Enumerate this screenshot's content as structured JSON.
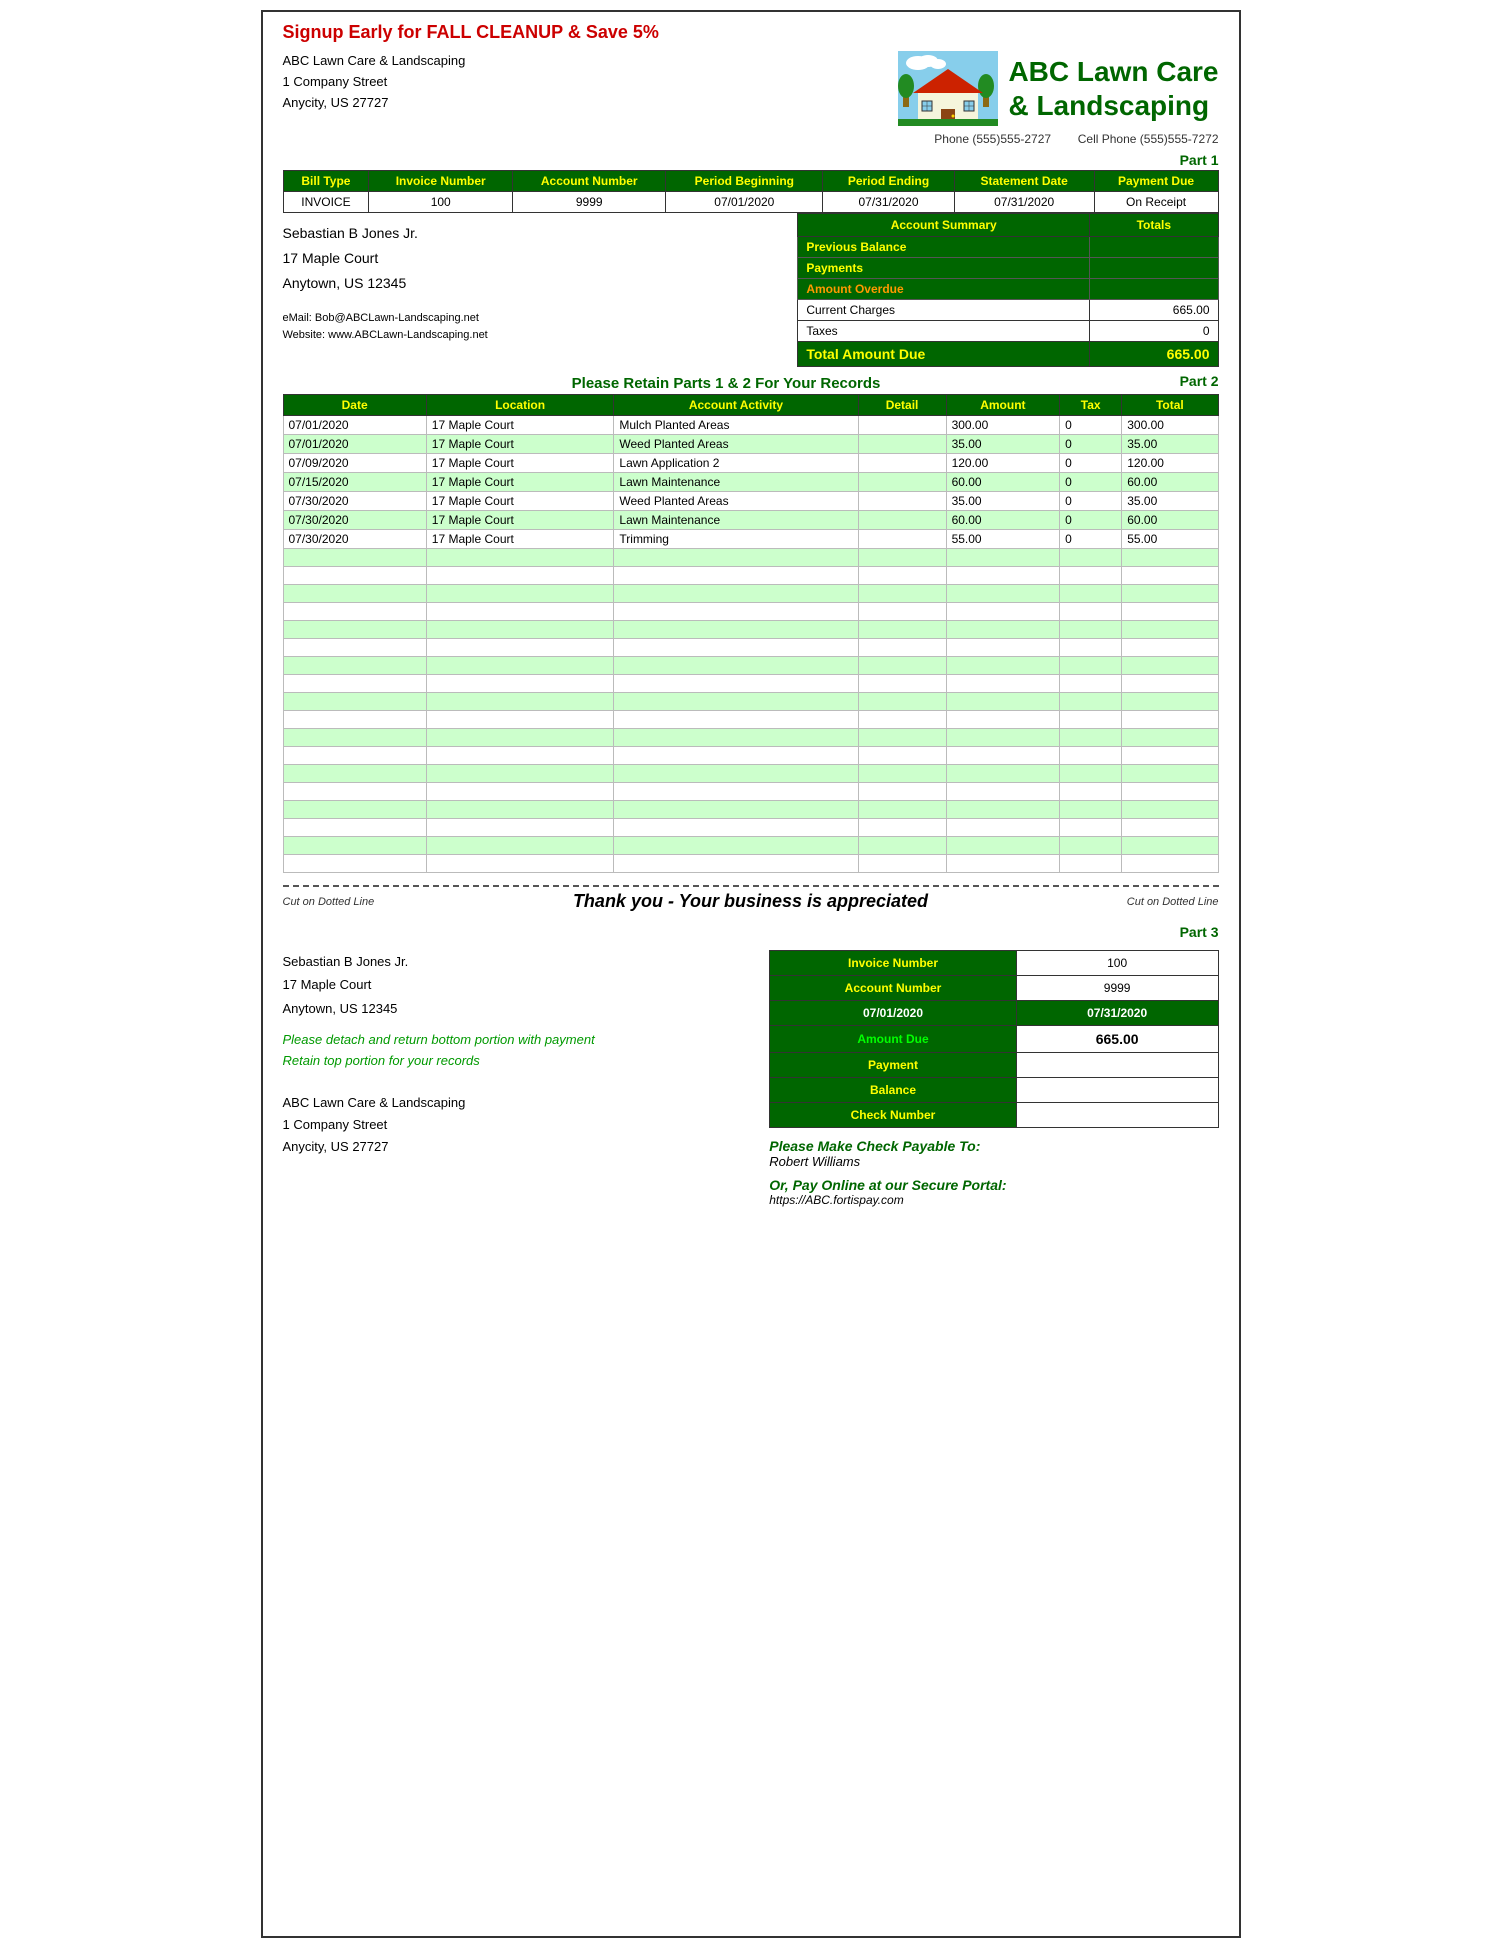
{
  "banner": "Signup Early for FALL CLEANUP & Save 5%",
  "company": {
    "name_line1": "ABC Lawn Care",
    "name_line2": "& Landscaping",
    "address_line1": "ABC Lawn Care & Landscaping",
    "address_line2": "1 Company Street",
    "address_line3": "Anycity, US  27727",
    "phone": "Phone  (555)555-2727",
    "cell": "Cell Phone  (555)555-7272",
    "email": "eMail:  Bob@ABCLawn-Landscaping.net",
    "website": "Website:  www.ABCLawn-Landscaping.net"
  },
  "part1_label": "Part 1",
  "invoice_table": {
    "headers": [
      "Bill Type",
      "Invoice Number",
      "Account Number",
      "Period Beginning",
      "Period Ending",
      "Statement Date",
      "Payment Due"
    ],
    "row": [
      "INVOICE",
      "100",
      "9999",
      "07/01/2020",
      "07/31/2020",
      "07/31/2020",
      "On Receipt"
    ]
  },
  "customer": {
    "name": "Sebastian B Jones Jr.",
    "address1": "17 Maple Court",
    "address2": "Anytown, US  12345"
  },
  "account_summary": {
    "title": "Account Summary",
    "totals_label": "Totals",
    "rows": [
      {
        "label": "Previous Balance",
        "amount": ""
      },
      {
        "label": "Payments",
        "amount": ""
      },
      {
        "label": "Amount Overdue",
        "amount": ""
      },
      {
        "label": "Current Charges",
        "amount": "665.00"
      },
      {
        "label": "Taxes",
        "amount": "0"
      }
    ],
    "total_label": "Total Amount Due",
    "total_amount": "665.00"
  },
  "retain_note": "Please Retain Parts 1 & 2 For Your Records",
  "part2_label": "Part 2",
  "activity_table": {
    "headers": [
      "Date",
      "Location",
      "Account Activity",
      "Detail",
      "Amount",
      "Tax",
      "Total"
    ],
    "rows": [
      {
        "date": "07/01/2020",
        "location": "17 Maple Court",
        "activity": "Mulch Planted Areas",
        "detail": "",
        "amount": "300.00",
        "tax": "0",
        "total": "300.00"
      },
      {
        "date": "07/01/2020",
        "location": "17 Maple Court",
        "activity": "Weed Planted Areas",
        "detail": "",
        "amount": "35.00",
        "tax": "0",
        "total": "35.00"
      },
      {
        "date": "07/09/2020",
        "location": "17 Maple Court",
        "activity": "Lawn Application 2",
        "detail": "",
        "amount": "120.00",
        "tax": "0",
        "total": "120.00"
      },
      {
        "date": "07/15/2020",
        "location": "17 Maple Court",
        "activity": "Lawn Maintenance",
        "detail": "",
        "amount": "60.00",
        "tax": "0",
        "total": "60.00"
      },
      {
        "date": "07/30/2020",
        "location": "17 Maple Court",
        "activity": "Weed Planted Areas",
        "detail": "",
        "amount": "35.00",
        "tax": "0",
        "total": "35.00"
      },
      {
        "date": "07/30/2020",
        "location": "17 Maple Court",
        "activity": "Lawn Maintenance",
        "detail": "",
        "amount": "60.00",
        "tax": "0",
        "total": "60.00"
      },
      {
        "date": "07/30/2020",
        "location": "17 Maple Court",
        "activity": "Trimming",
        "detail": "",
        "amount": "55.00",
        "tax": "0",
        "total": "55.00"
      }
    ],
    "empty_rows": 18
  },
  "cut_text_left": "Cut on Dotted Line",
  "cut_text_right": "Cut on Dotted Line",
  "thank_you": "Thank you - Your business is appreciated",
  "part3_label": "Part 3",
  "part3_customer": {
    "name": "Sebastian B Jones Jr.",
    "address1": "17 Maple Court",
    "address2": "Anytown, US  12345"
  },
  "detach_note_line1": "Please detach and return bottom portion with payment",
  "detach_note_line2": "Retain top portion for your records",
  "remit_address": {
    "line1": "ABC Lawn Care & Landscaping",
    "line2": "1 Company Street",
    "line3": "Anycity, US   27727"
  },
  "part3_table": {
    "invoice_label": "Invoice Number",
    "invoice_value": "100",
    "account_label": "Account Number",
    "account_value": "9999",
    "period_start": "07/01/2020",
    "period_end": "07/31/2020",
    "amount_due_label": "Amount Due",
    "amount_due_value": "665.00",
    "payment_label": "Payment",
    "payment_value": "",
    "balance_label": "Balance",
    "balance_value": "",
    "check_label": "Check Number",
    "check_value": ""
  },
  "pay_check_label": "Please Make Check Payable To:",
  "pay_check_name": "Robert Williams",
  "pay_online_label": "Or, Pay Online at our Secure Portal:",
  "pay_online_url": "https://ABC.fortispay.com"
}
